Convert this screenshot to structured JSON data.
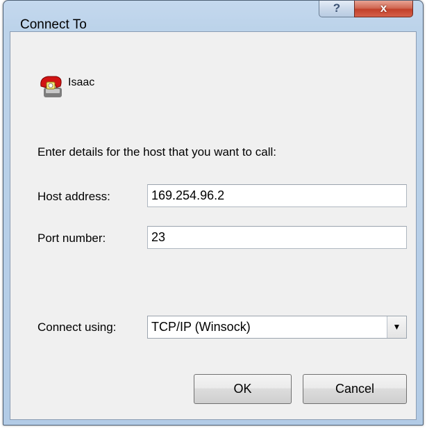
{
  "window": {
    "title": "Connect To",
    "help_label": "?",
    "close_label": "x"
  },
  "entry": {
    "name": "Isaac",
    "icon": "phone-icon"
  },
  "prompt": "Enter details for the host that you want to call:",
  "host": {
    "label": "Host address:",
    "value": "169.254.96.2"
  },
  "port": {
    "label": "Port number:",
    "value": "23"
  },
  "connect": {
    "label": "Connect using:",
    "value": "TCP/IP (Winsock)"
  },
  "buttons": {
    "ok": "OK",
    "cancel": "Cancel"
  },
  "colors": {
    "frame": "#b9cfe8",
    "close_button": "#c7472f",
    "client_bg": "#f0f0f0"
  }
}
